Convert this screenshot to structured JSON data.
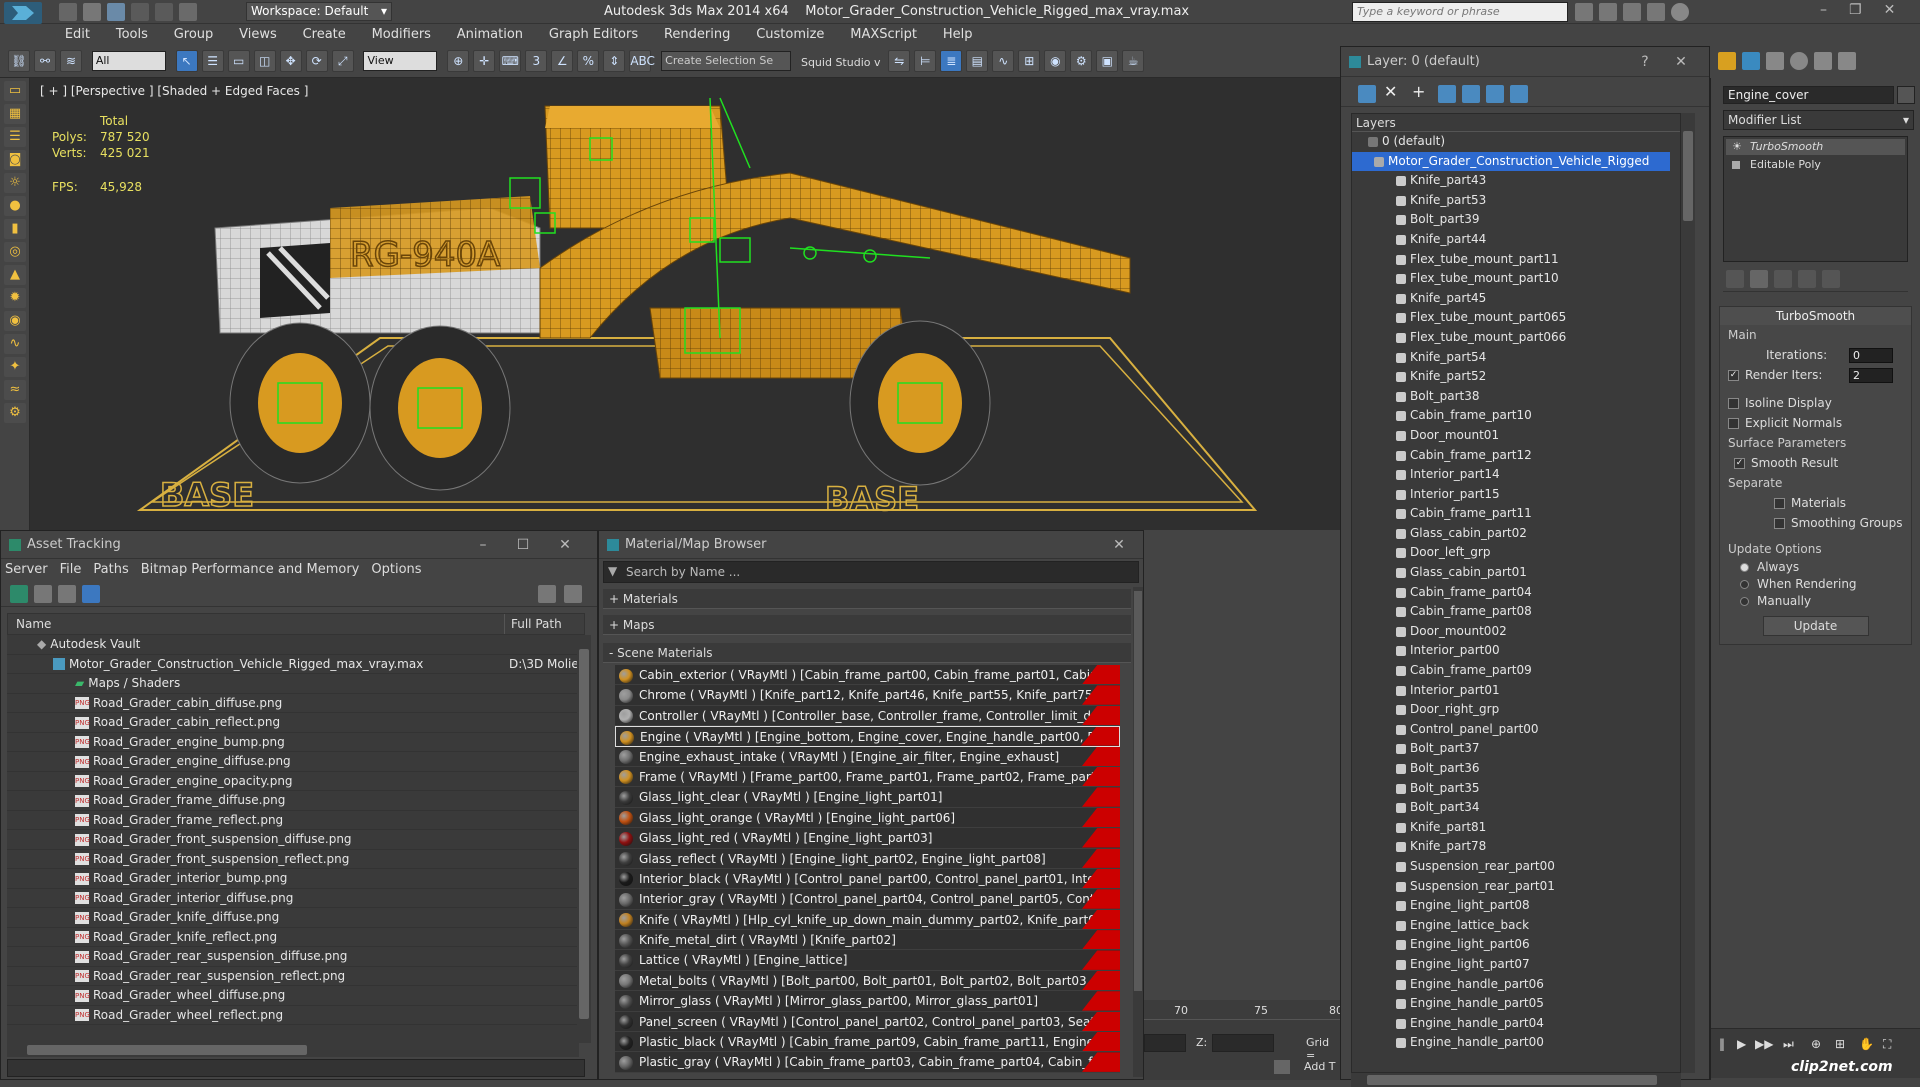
{
  "titlebar": {
    "workspace": "Workspace: Default",
    "app_title": "Autodesk 3ds Max  2014 x64",
    "file_name": "Motor_Grader_Construction_Vehicle_Rigged_max_vray.max",
    "search_placeholder": "Type a keyword or phrase"
  },
  "menu": [
    "Edit",
    "Tools",
    "Group",
    "Views",
    "Create",
    "Modifiers",
    "Animation",
    "Graph Editors",
    "Rendering",
    "Customize",
    "MAXScript",
    "Help"
  ],
  "toolbar": {
    "filter_select": "All",
    "ref_coord": "View",
    "selection_set": "Create Selection Se",
    "squid": "Squid Studio v"
  },
  "viewport": {
    "label": "[ + ] [Perspective ] [Shaded + Edged Faces ]",
    "stats_header": "Total",
    "polys_label": "Polys:",
    "polys_value": "787 520",
    "verts_label": "Verts:",
    "verts_value": "425 021",
    "fps_label": "FPS:",
    "fps_value": "45,928",
    "base_text_left": "BASE",
    "base_text_right": "BASE",
    "vehicle_text": "RG-940A"
  },
  "asset_tracking": {
    "title": "Asset Tracking",
    "menu": [
      "Server",
      "File",
      "Paths",
      "Bitmap Performance and Memory",
      "Options"
    ],
    "col_name": "Name",
    "col_path": "Full Path",
    "vault": "Autodesk Vault",
    "scene_file": "Motor_Grader_Construction_Vehicle_Rigged_max_vray.max",
    "scene_path": "D:\\3D Molie",
    "maps_folder": "Maps / Shaders",
    "files": [
      "Road_Grader_cabin_diffuse.png",
      "Road_Grader_cabin_reflect.png",
      "Road_Grader_engine_bump.png",
      "Road_Grader_engine_diffuse.png",
      "Road_Grader_engine_opacity.png",
      "Road_Grader_frame_diffuse.png",
      "Road_Grader_frame_reflect.png",
      "Road_Grader_front_suspension_diffuse.png",
      "Road_Grader_front_suspension_reflect.png",
      "Road_Grader_interior_bump.png",
      "Road_Grader_interior_diffuse.png",
      "Road_Grader_knife_diffuse.png",
      "Road_Grader_knife_reflect.png",
      "Road_Grader_rear_suspension_diffuse.png",
      "Road_Grader_rear_suspension_reflect.png",
      "Road_Grader_wheel_diffuse.png",
      "Road_Grader_wheel_reflect.png"
    ]
  },
  "material_browser": {
    "title": "Material/Map Browser",
    "search_placeholder": "Search by Name ...",
    "group_materials": "+ Materials",
    "group_maps": "+ Maps",
    "group_scene": "- Scene Materials",
    "materials": [
      {
        "text": "Cabin_exterior  ( VRayMtl ) [Cabin_frame_part00, Cabin_frame_part01, Cabin_fr...",
        "color": "#d09020"
      },
      {
        "text": "Chrome  ( VRayMtl ) [Knife_part12, Knife_part46, Knife_part55, Knife_part75, K...",
        "color": "#8a8a8a"
      },
      {
        "text": "Controller  ( VRayMtl ) [Controller_base, Controller_frame, Controller_limit_door...",
        "color": "#b0b0b0"
      },
      {
        "text": "Engine  ( VRayMtl ) [Engine_bottom, Engine_cover, Engine_handle_part00, Engi...",
        "color": "#d09020"
      },
      {
        "text": "Engine_exhaust_intake  ( VRayMtl ) [Engine_air_filter, Engine_exhaust]",
        "color": "#707070"
      },
      {
        "text": "Frame  ( VRayMtl ) [Frame_part00, Frame_part01, Frame_part02, Frame_part03...",
        "color": "#d09020"
      },
      {
        "text": "Glass_light_clear  ( VRayMtl ) [Engine_light_part01]",
        "color": "#3a3a3a"
      },
      {
        "text": "Glass_light_orange  ( VRayMtl ) [Engine_light_part06]",
        "color": "#c05010"
      },
      {
        "text": "Glass_light_red  ( VRayMtl ) [Engine_light_part03]",
        "color": "#901010"
      },
      {
        "text": "Glass_reflect  ( VRayMtl ) [Engine_light_part02, Engine_light_part08]",
        "color": "#404040"
      },
      {
        "text": "Interior_black  ( VRayMtl ) [Control_panel_part00, Control_panel_part01, Interio...",
        "color": "#1a1a1a"
      },
      {
        "text": "Interior_gray  ( VRayMtl ) [Control_panel_part04, Control_panel_part05, Control...",
        "color": "#6a6a6a"
      },
      {
        "text": "Knife  ( VRayMtl ) [Hlp_cyl_knife_up_down_main_dummy_part02, Knife_part00,...",
        "color": "#c08020"
      },
      {
        "text": "Knife_metal_dirt  ( VRayMtl ) [Knife_part02]",
        "color": "#555555"
      },
      {
        "text": "Lattice  ( VRayMtl ) [Engine_lattice]",
        "color": "#444444"
      },
      {
        "text": "Metal_bolts  ( VRayMtl ) [Bolt_part00, Bolt_part01, Bolt_part02, Bolt_part03, Bol...",
        "color": "#777777"
      },
      {
        "text": "Mirror_glass  ( VRayMtl ) [Mirror_glass_part00, Mirror_glass_part01]",
        "color": "#505050"
      },
      {
        "text": "Panel_screen  ( VRayMtl ) [Control_panel_part02, Control_panel_part03, Seat_p...",
        "color": "#303030"
      },
      {
        "text": "Plastic_black  ( VRayMtl ) [Cabin_frame_part09, Cabin_frame_part11, Engine_lat...",
        "color": "#222222"
      },
      {
        "text": "Plastic_gray  ( VRayMtl ) [Cabin_frame_part03, Cabin_frame_part04, Cabin_fra...",
        "color": "#666666"
      }
    ]
  },
  "layer_explorer": {
    "title": "Layer: 0 (default)",
    "header": "Layers",
    "default_layer": "0 (default)",
    "selected_layer": "Motor_Grader_Construction_Vehicle_Rigged",
    "objects": [
      "Knife_part43",
      "Knife_part53",
      "Bolt_part39",
      "Knife_part44",
      "Flex_tube_mount_part11",
      "Flex_tube_mount_part10",
      "Knife_part45",
      "Flex_tube_mount_part065",
      "Flex_tube_mount_part066",
      "Knife_part54",
      "Knife_part52",
      "Bolt_part38",
      "Cabin_frame_part10",
      "Door_mount01",
      "Cabin_frame_part12",
      "Interior_part14",
      "Interior_part15",
      "Cabin_frame_part11",
      "Glass_cabin_part02",
      "Door_left_grp",
      "Glass_cabin_part01",
      "Cabin_frame_part04",
      "Cabin_frame_part08",
      "Door_mount002",
      "Interior_part00",
      "Cabin_frame_part09",
      "Interior_part01",
      "Door_right_grp",
      "Control_panel_part00",
      "Bolt_part37",
      "Bolt_part36",
      "Bolt_part35",
      "Bolt_part34",
      "Knife_part81",
      "Knife_part78",
      "Suspension_rear_part00",
      "Suspension_rear_part01",
      "Engine_light_part08",
      "Engine_lattice_back",
      "Engine_light_part06",
      "Engine_light_part07",
      "Engine_handle_part06",
      "Engine_handle_part05",
      "Engine_handle_part04",
      "Engine_handle_part00"
    ]
  },
  "command_panel": {
    "object_name": "Engine_cover",
    "modifier_list": "Modifier List",
    "stack": [
      "TurboSmooth",
      "Editable Poly"
    ],
    "rollout_title": "TurboSmooth",
    "main_label": "Main",
    "iterations_label": "Iterations:",
    "iterations_value": "0",
    "render_iters_label": "Render Iters:",
    "render_iters_value": "2",
    "isoline": "Isoline Display",
    "explicit_normals": "Explicit Normals",
    "surface_params": "Surface Parameters",
    "smooth_result": "Smooth Result",
    "separate": "Separate",
    "materials": "Materials",
    "smoothing_groups": "Smoothing Groups",
    "update_options": "Update Options",
    "always": "Always",
    "when_rendering": "When Rendering",
    "manually": "Manually",
    "update_button": "Update"
  },
  "timeline": {
    "ticks": [
      "70",
      "75",
      "80"
    ],
    "z_label": "Z:",
    "grid_label": "Grid =",
    "add_label": "Add T"
  },
  "watermark": "clip2net.com"
}
